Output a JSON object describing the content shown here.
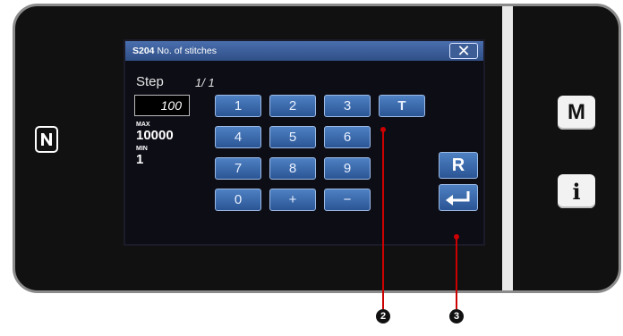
{
  "dialog": {
    "code": "S204",
    "title": "No. of stitches",
    "close_glyph": "✕"
  },
  "step": {
    "label": "Step",
    "value": "1/ 1"
  },
  "input": {
    "value": "100"
  },
  "limits": {
    "max_label": "MAX",
    "max_value": "10000",
    "min_label": "MIN",
    "min_value": "1"
  },
  "keypad": {
    "keys": [
      "1",
      "2",
      "3",
      "T",
      "4",
      "5",
      "6",
      "7",
      "8",
      "9",
      "0",
      "+",
      "−"
    ],
    "reset_label": "R",
    "enter_glyph": "↵"
  },
  "hardware": {
    "menu_label": "M",
    "info_label": "i"
  },
  "callouts": {
    "two": "2",
    "three": "3"
  },
  "colors": {
    "titlebar": "#3a60a0",
    "key": "#3566a8",
    "callout": "#cc0000"
  }
}
